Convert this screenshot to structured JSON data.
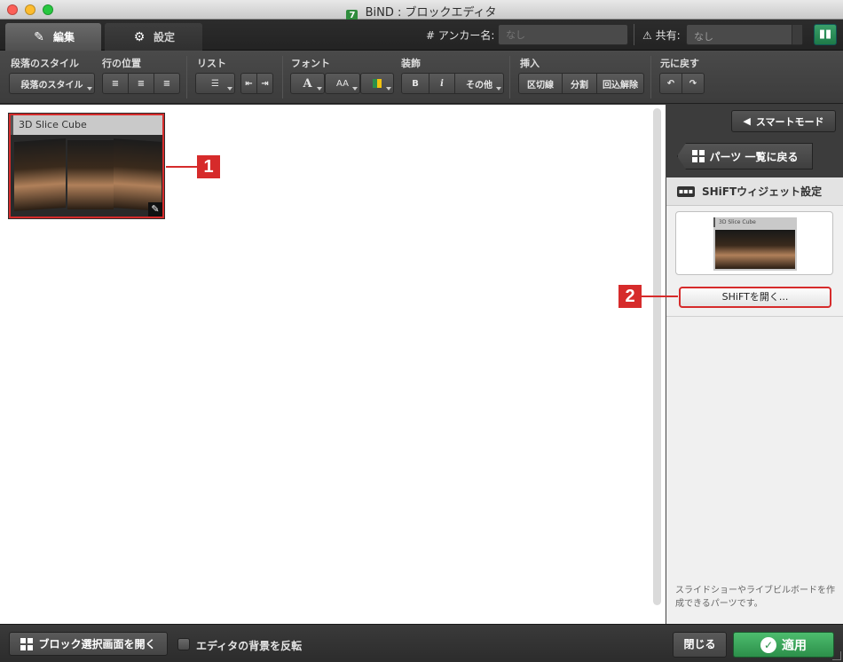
{
  "window": {
    "title": "BiND : ブロックエディタ",
    "app_icon": "7"
  },
  "tabs": [
    {
      "label": "編集",
      "icon": "pencil-icon",
      "active": true
    },
    {
      "label": "設定",
      "icon": "gear-icon",
      "active": false
    }
  ],
  "anchor": {
    "label": "# アンカー名:",
    "placeholder": "なし"
  },
  "share": {
    "label": "共有:",
    "value": "なし"
  },
  "toolbar": {
    "groups": {
      "paragraph_style": "段落のスタイル",
      "line_position": "行の位置",
      "list": "リスト",
      "font": "フォント",
      "decoration": "装飾",
      "insert": "挿入",
      "undo_group": "元に戻す"
    },
    "paragraph_style_button": "段落のスタイル",
    "font_size_button": "AA",
    "bold_button": "B",
    "italic_button": "i",
    "other_button": "その他",
    "insert_buttons": [
      "区切線",
      "分割",
      "回込解除"
    ]
  },
  "editor": {
    "widget_title": "3D Slice Cube"
  },
  "callouts": [
    "1",
    "2"
  ],
  "right_panel": {
    "smart_mode_button": "スマートモード",
    "back_to_parts_button": "パーツ 一覧に戻る",
    "section_title": "SHiFTウィジェット設定",
    "thumbnail_title": "3D Slice Cube",
    "open_shift_button": "SHiFTを開く...",
    "description": "スライドショーやライブビルボードを作成できるパーツです。"
  },
  "bottom": {
    "open_block_select_button": "ブロック選択画面を開く",
    "invert_background_label": "エディタの背景を反転",
    "close_button": "閉じる",
    "apply_button": "適用"
  },
  "colors": {
    "accent_red": "#d62b2b",
    "apply_green": "#2c8f4a",
    "dark_bg": "#3a3a3a"
  }
}
